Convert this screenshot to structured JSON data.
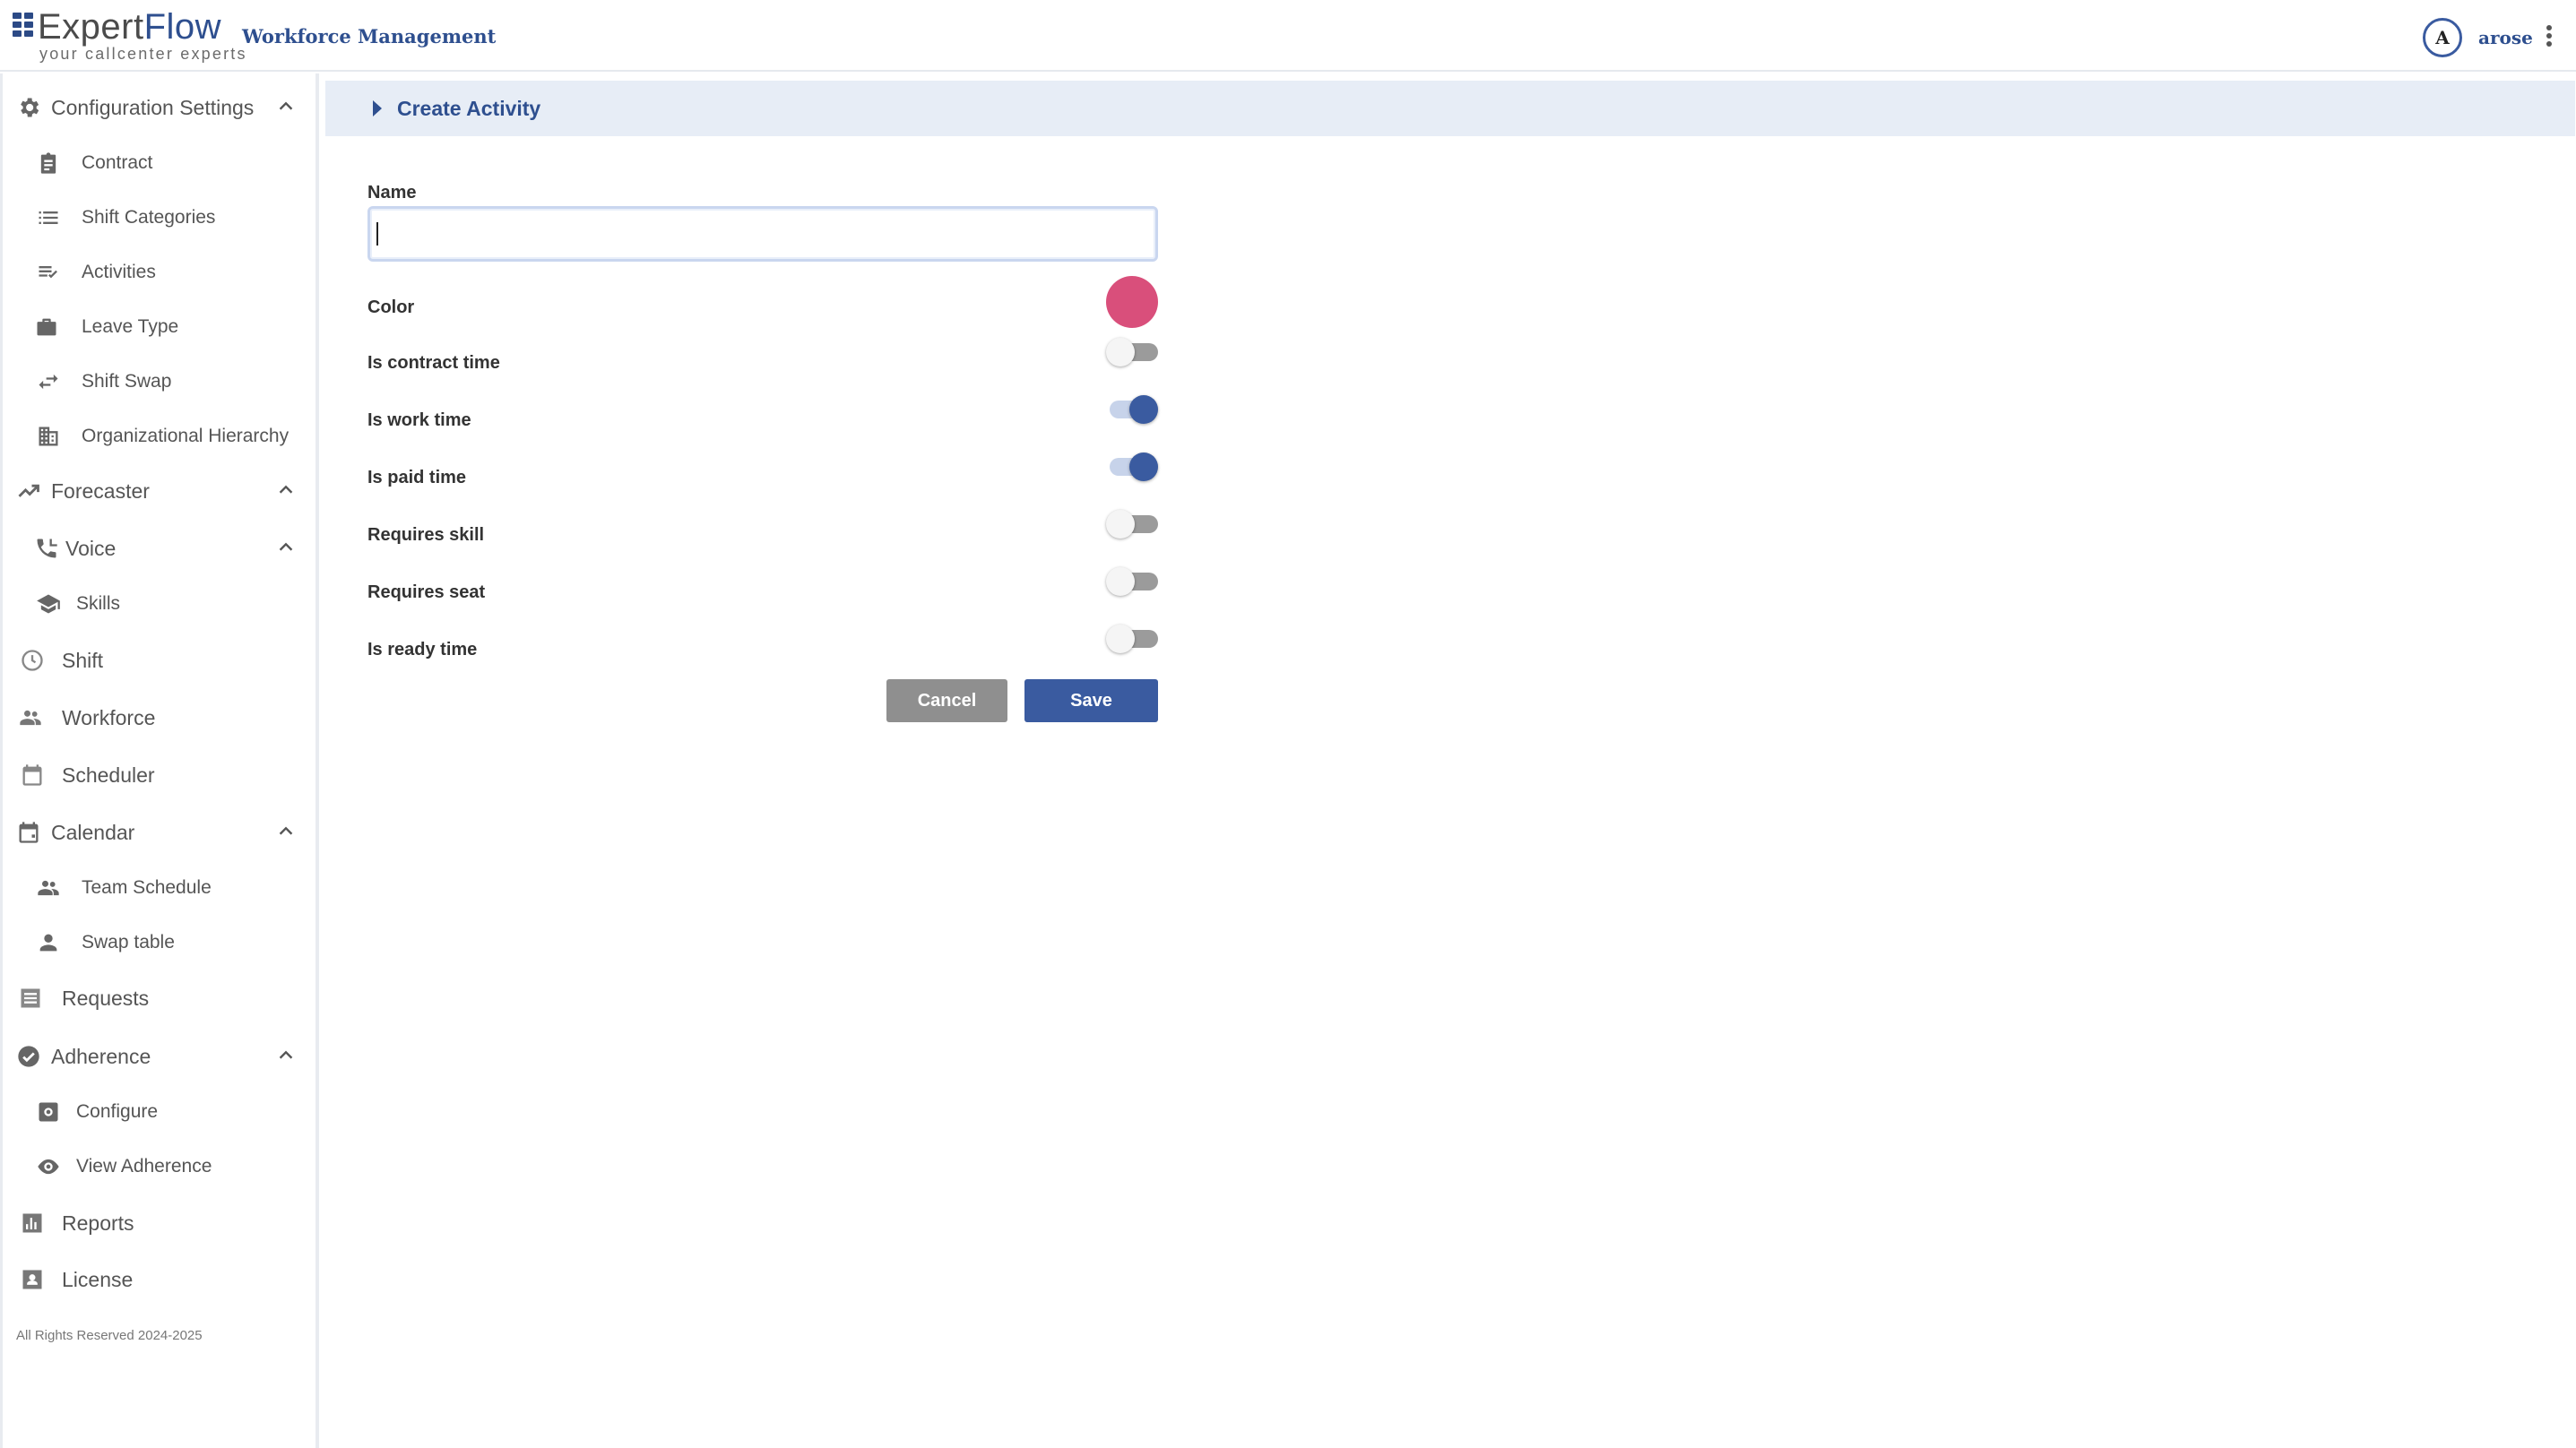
{
  "header": {
    "logo_main": "Expert",
    "logo_accent": "Flow",
    "logo_tagline": "your callcenter experts",
    "app_title": "Workforce Management",
    "avatar_initial": "A",
    "username": "arose"
  },
  "sidebar": {
    "config_settings": "Configuration Settings",
    "contract": "Contract",
    "shift_categories": "Shift Categories",
    "activities": "Activities",
    "leave_type": "Leave Type",
    "shift_swap": "Shift Swap",
    "org_hierarchy": "Organizational Hierarchy",
    "forecaster": "Forecaster",
    "voice": "Voice",
    "skills": "Skills",
    "shift": "Shift",
    "workforce": "Workforce",
    "scheduler": "Scheduler",
    "calendar": "Calendar",
    "team_schedule": "Team Schedule",
    "swap_table": "Swap table",
    "requests": "Requests",
    "adherence": "Adherence",
    "configure": "Configure",
    "view_adherence": "View Adherence",
    "reports": "Reports",
    "license": "License",
    "footer": "All Rights Reserved 2024-2025"
  },
  "form": {
    "panel_title": "Create Activity",
    "name_label": "Name",
    "name_value": "",
    "color_label": "Color",
    "color_value": "#d94f7b",
    "contract_time_label": "Is contract time",
    "contract_time_on": false,
    "work_time_label": "Is work time",
    "work_time_on": true,
    "paid_time_label": "Is paid time",
    "paid_time_on": true,
    "requires_skill_label": "Requires skill",
    "requires_skill_on": false,
    "requires_seat_label": "Requires seat",
    "requires_seat_on": false,
    "ready_time_label": "Is ready time",
    "ready_time_on": false,
    "cancel_label": "Cancel",
    "save_label": "Save"
  },
  "colors": {
    "brand": "#2e4f8f",
    "primary_button": "#3a5ba0",
    "cancel_button": "#8f8f8f",
    "panel_header_bg": "#e7edf6"
  }
}
